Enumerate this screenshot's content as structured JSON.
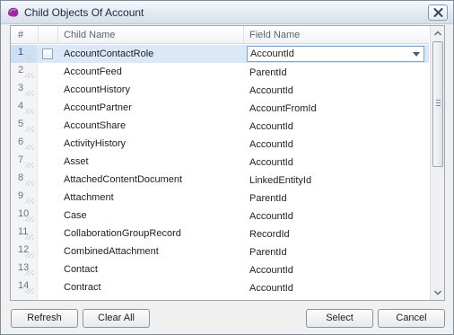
{
  "window": {
    "title": "Child Objects Of Account",
    "icon": "purple-app-icon"
  },
  "columns": {
    "num": "#",
    "child": "Child Name",
    "field": "Field Name"
  },
  "rows": [
    {
      "num": "1",
      "child": "AccountContactRole",
      "field": "AccountId"
    },
    {
      "num": "2",
      "child": "AccountFeed",
      "field": "ParentId"
    },
    {
      "num": "3",
      "child": "AccountHistory",
      "field": "AccountId"
    },
    {
      "num": "4",
      "child": "AccountPartner",
      "field": "AccountFromId"
    },
    {
      "num": "5",
      "child": "AccountShare",
      "field": "AccountId"
    },
    {
      "num": "6",
      "child": "ActivityHistory",
      "field": "AccountId"
    },
    {
      "num": "7",
      "child": "Asset",
      "field": "AccountId"
    },
    {
      "num": "8",
      "child": "AttachedContentDocument",
      "field": "LinkedEntityId"
    },
    {
      "num": "9",
      "child": "Attachment",
      "field": "ParentId"
    },
    {
      "num": "10",
      "child": "Case",
      "field": "AccountId"
    },
    {
      "num": "11",
      "child": "CollaborationGroupRecord",
      "field": "RecordId"
    },
    {
      "num": "12",
      "child": "CombinedAttachment",
      "field": "ParentId"
    },
    {
      "num": "13",
      "child": "Contact",
      "field": "AccountId"
    },
    {
      "num": "14",
      "child": "Contract",
      "field": "AccountId"
    }
  ],
  "selected_row_index": 0,
  "buttons": {
    "refresh": "Refresh",
    "clear_all": "Clear All",
    "select": "Select",
    "cancel": "Cancel"
  },
  "colors": {
    "selection": "#dbe8f7",
    "icon_purple": "#9b2d9a"
  }
}
